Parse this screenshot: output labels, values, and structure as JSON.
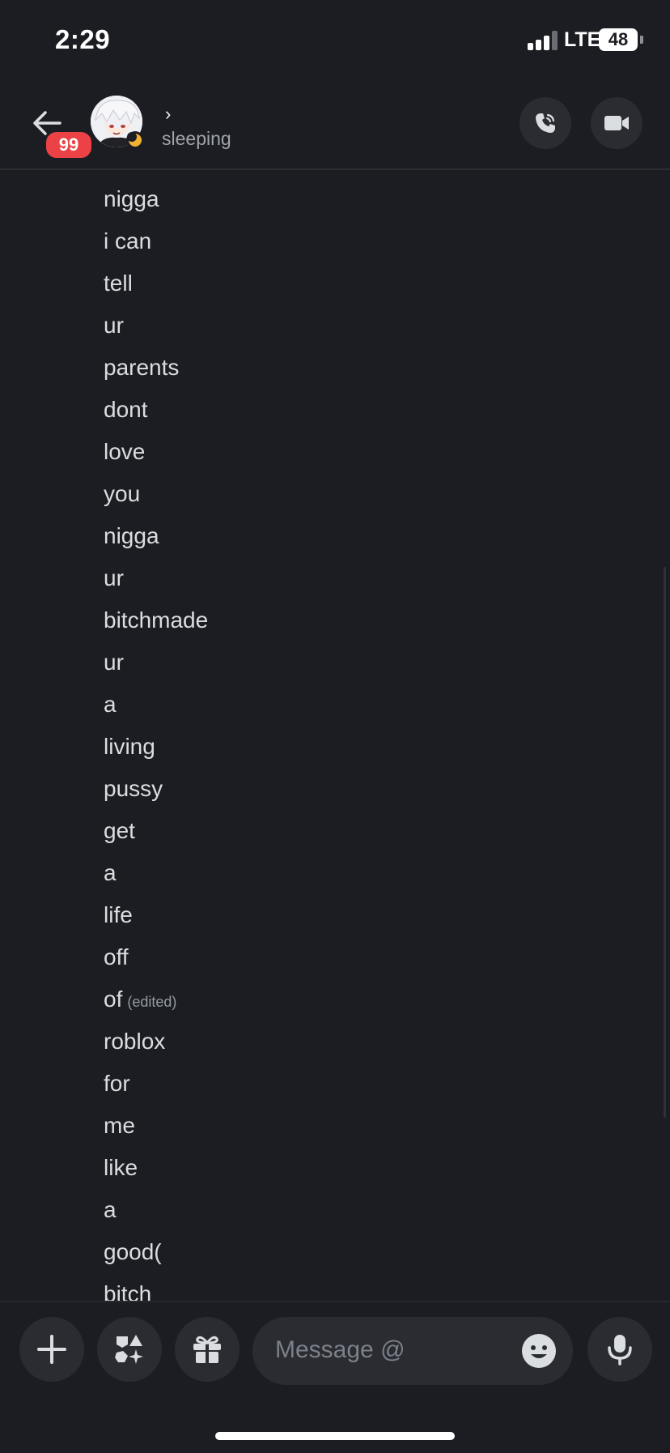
{
  "status_bar": {
    "time": "2:29",
    "network": "LTE",
    "battery": "48"
  },
  "header": {
    "unread_badge": "99",
    "dm_name": "",
    "dm_status": "sleeping",
    "chevron": "›"
  },
  "messages": [
    {
      "text": "nigga"
    },
    {
      "text": "i can"
    },
    {
      "text": "tell"
    },
    {
      "text": "ur"
    },
    {
      "text": "parents"
    },
    {
      "text": "dont"
    },
    {
      "text": "love"
    },
    {
      "text": "you"
    },
    {
      "text": "nigga"
    },
    {
      "text": "ur"
    },
    {
      "text": "bitchmade"
    },
    {
      "text": "ur"
    },
    {
      "text": "a"
    },
    {
      "text": "living"
    },
    {
      "text": "pussy"
    },
    {
      "text": "get"
    },
    {
      "text": "a"
    },
    {
      "text": "life"
    },
    {
      "text": "off"
    },
    {
      "text": "of",
      "edited": "(edited)"
    },
    {
      "text": "roblox"
    },
    {
      "text": "for"
    },
    {
      "text": "me"
    },
    {
      "text": "like"
    },
    {
      "text": "a"
    },
    {
      "text": "good("
    },
    {
      "text": "bitch"
    }
  ],
  "composer": {
    "placeholder": "Message @"
  },
  "icons": {
    "back": "arrow-left-icon",
    "call": "phone-icon",
    "video": "video-camera-icon",
    "add": "plus-icon",
    "apps": "apps-icon",
    "gift": "gift-icon",
    "emoji": "emoji-icon",
    "mic": "microphone-icon"
  },
  "colors": {
    "badge": "#ed4245",
    "idle": "#f0b232",
    "background": "#1c1d22"
  }
}
